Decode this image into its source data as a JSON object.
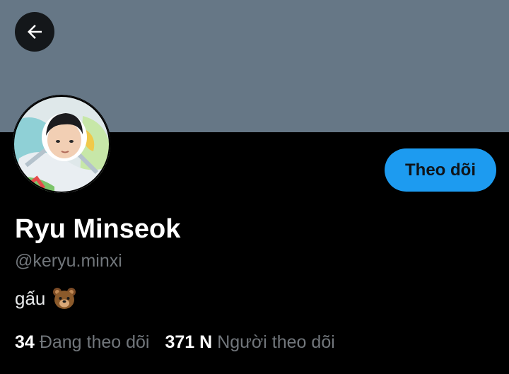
{
  "profile": {
    "display_name": "Ryu Minseok",
    "handle": "@keryu.minxi",
    "bio_text": "gấu",
    "bio_emoji": "bear-face-icon"
  },
  "actions": {
    "follow_label": "Theo dõi",
    "back_icon": "arrow-left-icon"
  },
  "stats": {
    "following_count": "34",
    "following_label": "Đang theo dõi",
    "followers_count": "371 N",
    "followers_label": "Người theo dõi"
  },
  "colors": {
    "banner": "#667786",
    "background": "#000000",
    "accent": "#1d9bf0",
    "secondary_text": "#71767b"
  }
}
